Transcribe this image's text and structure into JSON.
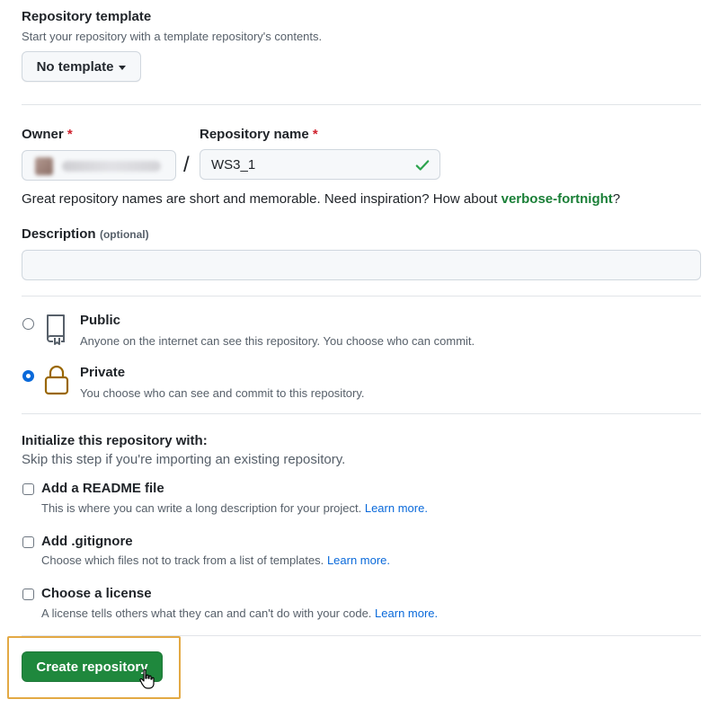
{
  "template": {
    "heading": "Repository template",
    "subtext": "Start your repository with a template repository's contents.",
    "button_label": "No template"
  },
  "owner": {
    "label": "Owner",
    "required_mark": "*"
  },
  "repo_name": {
    "label": "Repository name",
    "required_mark": "*",
    "value": "WS3_1",
    "hint_prefix": "Great repository names are short and memorable. Need inspiration? How about ",
    "hint_suggestion": "verbose-fortnight",
    "hint_suffix": "?"
  },
  "description": {
    "label": "Description",
    "optional_tag": "(optional)",
    "value": ""
  },
  "visibility": {
    "public": {
      "title": "Public",
      "desc": "Anyone on the internet can see this repository. You choose who can commit.",
      "selected": false
    },
    "private": {
      "title": "Private",
      "desc": "You choose who can see and commit to this repository.",
      "selected": true
    }
  },
  "initialize": {
    "heading": "Initialize this repository with:",
    "subtext": "Skip this step if you're importing an existing repository.",
    "options": [
      {
        "title": "Add a README file",
        "desc": "This is where you can write a long description for your project.",
        "link": "Learn more."
      },
      {
        "title": "Add .gitignore",
        "desc": "Choose which files not to track from a list of templates.",
        "link": "Learn more."
      },
      {
        "title": "Choose a license",
        "desc": "A license tells others what they can and can't do with your code.",
        "link": "Learn more."
      }
    ]
  },
  "create_button_label": "Create repository",
  "colors": {
    "primary_green": "#1f883d",
    "link_blue": "#0969da",
    "suggestion_green": "#1a7f37",
    "highlight": "#e3a944",
    "required_red": "#cf222e"
  }
}
